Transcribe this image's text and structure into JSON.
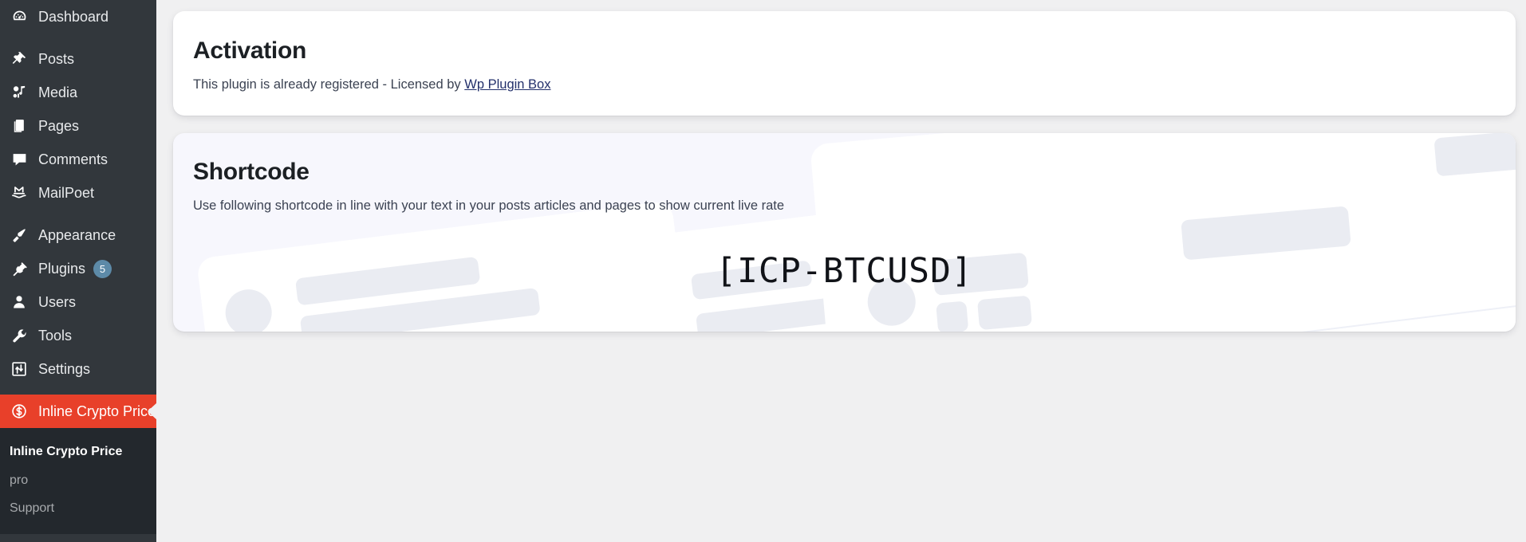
{
  "theme": {
    "sidebar_bg": "#32373c",
    "submenu_bg": "#23282d",
    "active_bg": "#e8402a",
    "page_bg": "#f0f0f1",
    "card_bg": "#ffffff",
    "shortcode_card_bg": "#f7f7fd",
    "badge_bg": "#5d8aa8",
    "link_color": "#23306b",
    "heading_color": "#1c2024"
  },
  "sidebar": {
    "items": [
      {
        "label": "Dashboard",
        "icon": "dashboard-icon",
        "badge": null
      },
      {
        "label": "Posts",
        "icon": "pin-icon",
        "badge": null
      },
      {
        "label": "Media",
        "icon": "media-icon",
        "badge": null
      },
      {
        "label": "Pages",
        "icon": "pages-icon",
        "badge": null
      },
      {
        "label": "Comments",
        "icon": "comment-icon",
        "badge": null
      },
      {
        "label": "MailPoet",
        "icon": "mailpoet-icon",
        "badge": null
      },
      {
        "label": "Appearance",
        "icon": "brush-icon",
        "badge": null
      },
      {
        "label": "Plugins",
        "icon": "plug-icon",
        "badge": "5"
      },
      {
        "label": "Users",
        "icon": "user-icon",
        "badge": null
      },
      {
        "label": "Tools",
        "icon": "wrench-icon",
        "badge": null
      },
      {
        "label": "Settings",
        "icon": "settings-icon",
        "badge": null
      },
      {
        "label": "Inline Crypto Price",
        "icon": "dollar-circle-icon",
        "badge": null
      }
    ],
    "active_item": "Inline Crypto Price",
    "submenu": [
      {
        "label": "Inline Crypto Price",
        "current": true
      },
      {
        "label": "pro",
        "current": false
      },
      {
        "label": "Support",
        "current": false
      }
    ]
  },
  "activation_card": {
    "title": "Activation",
    "description_prefix": "This plugin is already registered - Licensed by ",
    "link_label": "Wp Plugin Box"
  },
  "shortcode_card": {
    "title": "Shortcode",
    "description": "Use following shortcode in line with your text in your posts articles and pages to show current live rate",
    "shortcode": "[ICP-BTCUSD]"
  }
}
